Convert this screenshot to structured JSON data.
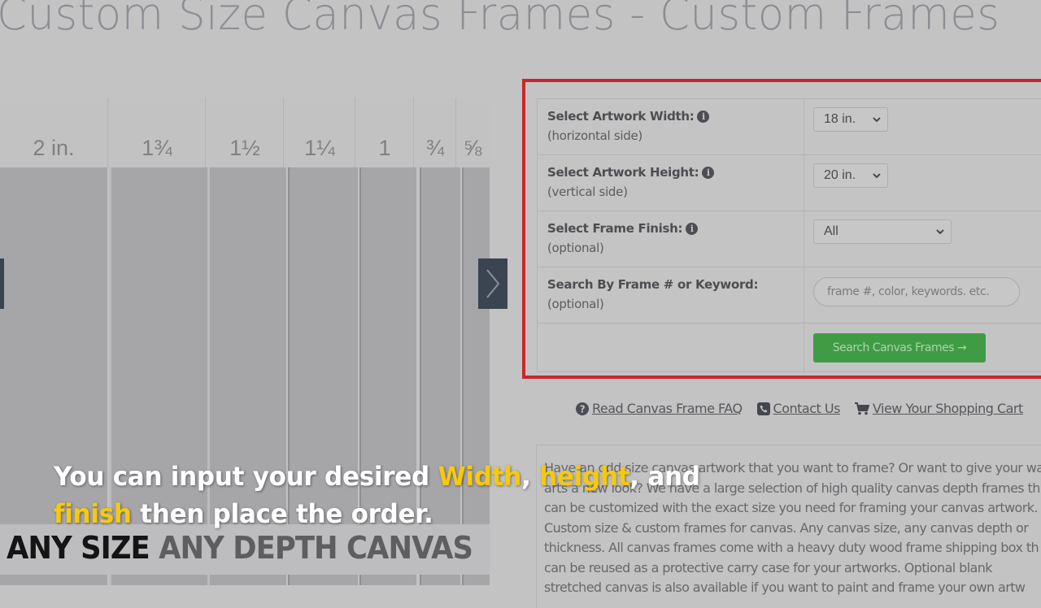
{
  "page": {
    "title": "Custom Size Canvas Frames - Custom Frames"
  },
  "sample_image": {
    "depth_labels": [
      "2 in.",
      "1¾",
      "1½",
      "1¼",
      "1",
      "¾",
      "⅝"
    ],
    "caption_part1": "ANY SIZE",
    "caption_part2": "ANY DEPTH CANVAS",
    "prev_icon": "chevron-left-icon",
    "next_icon": "chevron-right-icon"
  },
  "form": {
    "highlight_color": "#c8262d",
    "rows": [
      {
        "label": "Select Artwork Width:",
        "sublabel": "(horizontal side)",
        "value": "18 in.",
        "info_icon": "info-circle-icon"
      },
      {
        "label": "Select Artwork Height:",
        "sublabel": "(vertical side)",
        "value": "20 in.",
        "info_icon": "info-circle-icon"
      },
      {
        "label": "Select Frame Finish:",
        "sublabel": "(optional)",
        "value": "All",
        "info_icon": "info-circle-icon"
      },
      {
        "label": "Search By Frame # or Keyword:",
        "sublabel": "(optional)",
        "placeholder": "frame #, color, keywords. etc.",
        "value": ""
      }
    ],
    "submit_label": "Search Canvas Frames →",
    "submit_color": "#3f9c44"
  },
  "links": [
    {
      "label": "Read Canvas Frame FAQ",
      "icon": "question-circle-icon"
    },
    {
      "label": "Contact Us",
      "icon": "phone-icon"
    },
    {
      "label": "View Your Shopping Cart",
      "icon": "cart-icon"
    }
  ],
  "description": {
    "lines": [
      "Have an odd size canvas artwork that you want to frame? Or want to give your wa",
      "arts a new look? We have a large selection of high quality canvas depth frames th",
      "can be customized with the exact size you need for framing your canvas artwork.",
      "Custom size & custom frames for canvas. Any canvas size, any canvas depth or",
      "thickness. All canvas frames come with a heavy duty wood frame shipping box th",
      "can be reused as a protective carry case for your artworks. Optional blank",
      "stretched canvas is also available if you want to paint and frame your own artw"
    ]
  },
  "subtitle": {
    "line1_pre": "You can input your desired ",
    "w1": "Width",
    "comma": ", ",
    "w2": "height",
    "line1_post": ", and",
    "w3": "finish",
    "line2_post": " then place the order.",
    "highlight_color": "#f6c90e"
  }
}
